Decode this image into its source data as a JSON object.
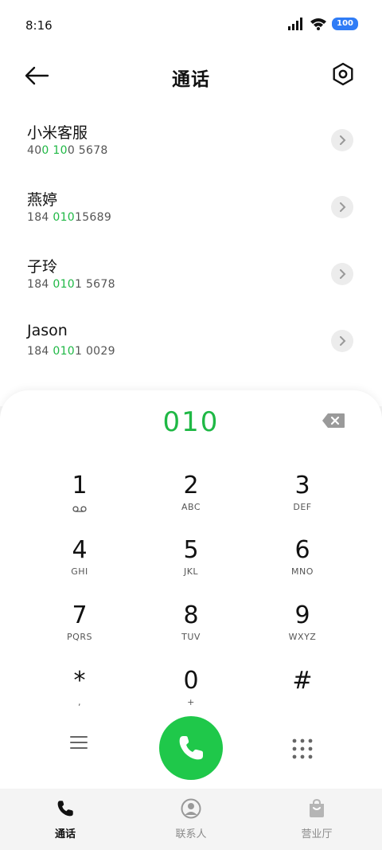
{
  "status": {
    "time": "8:16",
    "battery": "100"
  },
  "header": {
    "title": "通话"
  },
  "results": [
    {
      "name": "小米客服",
      "number_parts": [
        "40",
        "0",
        " ",
        "10",
        "0 5678"
      ]
    },
    {
      "name": "燕婷",
      "number_parts": [
        "184 ",
        "010",
        "15689"
      ]
    },
    {
      "name": "子玲",
      "number_parts": [
        "184 ",
        "010",
        "1 5678"
      ]
    },
    {
      "name": "Jason",
      "number_parts": [
        "184 ",
        "010",
        "1 0029"
      ]
    }
  ],
  "dialpad": {
    "display": "010",
    "keys": [
      {
        "digit": "1",
        "sub": ""
      },
      {
        "digit": "2",
        "sub": "ABC"
      },
      {
        "digit": "3",
        "sub": "DEF"
      },
      {
        "digit": "4",
        "sub": "GHI"
      },
      {
        "digit": "5",
        "sub": "JKL"
      },
      {
        "digit": "6",
        "sub": "MNO"
      },
      {
        "digit": "7",
        "sub": "PQRS"
      },
      {
        "digit": "8",
        "sub": "TUV"
      },
      {
        "digit": "9",
        "sub": "WXYZ"
      },
      {
        "digit": "*",
        "sub": ","
      },
      {
        "digit": "0",
        "sub": "+"
      },
      {
        "digit": "#",
        "sub": ""
      }
    ]
  },
  "tabs": [
    {
      "label": "通话",
      "active": true
    },
    {
      "label": "联系人",
      "active": false
    },
    {
      "label": "营业厅",
      "active": false
    }
  ],
  "colors": {
    "accent": "#1fc84a",
    "highlight": "#1fb845",
    "battery": "#2f7cf6"
  }
}
